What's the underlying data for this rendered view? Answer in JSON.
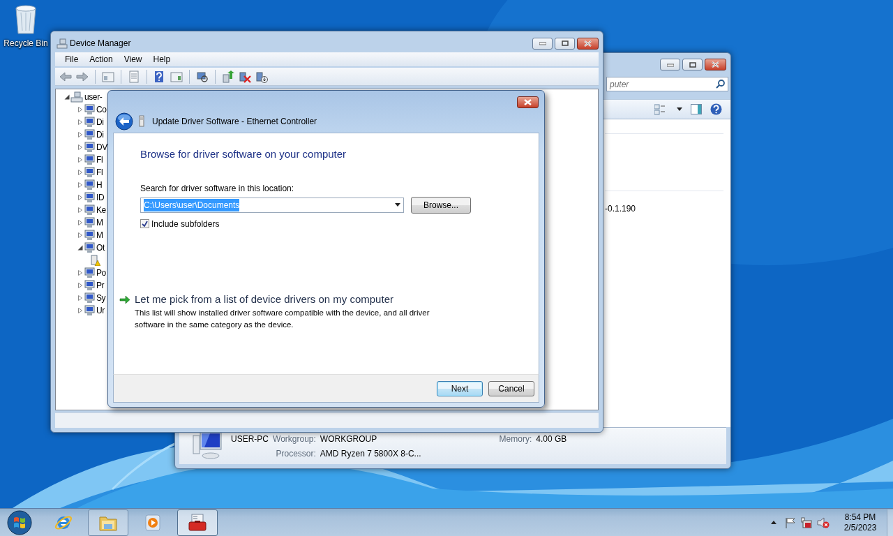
{
  "desktop_icons": [
    {
      "label": "Recycle Bin"
    }
  ],
  "computer_window": {
    "search_placeholder": "puter",
    "details_text": "-0.1.190",
    "info": {
      "name": "USER-PC",
      "fields": [
        {
          "label": "Workgroup:",
          "value": "WORKGROUP"
        },
        {
          "label": "Memory:",
          "value": "4.00 GB"
        },
        {
          "label": "Processor:",
          "value": "AMD Ryzen 7 5800X 8-C..."
        }
      ]
    }
  },
  "device_manager": {
    "title": "Device Manager",
    "menu": [
      "File",
      "Action",
      "View",
      "Help"
    ],
    "tree": [
      {
        "label": "user-",
        "expanded": true,
        "children": [
          {
            "label": "Co",
            "expanded": false
          },
          {
            "label": "Di",
            "expanded": false
          },
          {
            "label": "Di",
            "expanded": false
          },
          {
            "label": "DV",
            "expanded": false
          },
          {
            "label": "Fl",
            "expanded": false
          },
          {
            "label": "Fl",
            "expanded": false
          },
          {
            "label": "H",
            "expanded": false
          },
          {
            "label": "ID",
            "expanded": false
          },
          {
            "label": "Ke",
            "expanded": false
          },
          {
            "label": "M",
            "expanded": false
          },
          {
            "label": "M",
            "expanded": false
          },
          {
            "label": "Ot",
            "expanded": true,
            "children": [
              {
                "warning": true
              }
            ]
          },
          {
            "label": "Po",
            "expanded": false
          },
          {
            "label": "Pr",
            "expanded": false
          },
          {
            "label": "Sy",
            "expanded": false
          },
          {
            "label": "Ur",
            "expanded": false
          }
        ]
      }
    ]
  },
  "dialog": {
    "title": "Update Driver Software - Ethernet Controller",
    "heading": "Browse for driver software on your computer",
    "location_label": "Search for driver software in this location:",
    "location_value": "C:\\Users\\user\\Documents",
    "location_selected": true,
    "browse_button": "Browse...",
    "include_subfolders": {
      "label": "Include subfolders",
      "checked": true
    },
    "pick_option": {
      "title": "Let me pick from a list of device drivers on my computer",
      "description": "This list will show installed driver software compatible with the device, and all driver software in the same category as the device."
    },
    "buttons": [
      {
        "label": "Next",
        "default": true
      },
      {
        "label": "Cancel",
        "default": false
      }
    ]
  },
  "taskbar": {
    "items": [
      {
        "kind": "ie",
        "open": false,
        "selected": false
      },
      {
        "kind": "explorer",
        "open": true,
        "selected": false
      },
      {
        "kind": "media",
        "open": false,
        "selected": false
      },
      {
        "kind": "toolbox",
        "open": true,
        "selected": true
      }
    ],
    "time": "8:54 PM",
    "date": "2/5/2023"
  }
}
